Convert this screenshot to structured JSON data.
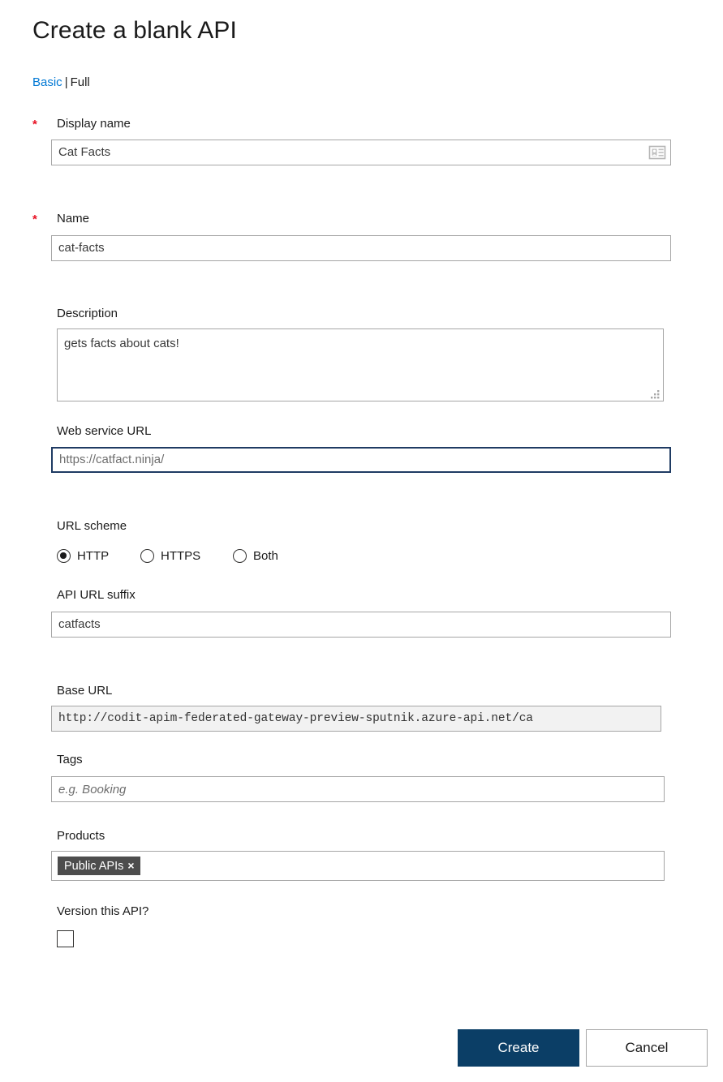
{
  "page": {
    "title": "Create a blank API"
  },
  "mode_switch": {
    "basic_label": "Basic",
    "separator": "|",
    "full_label": "Full"
  },
  "required_marker": "*",
  "fields": {
    "display_name": {
      "label": "Display name",
      "value": "Cat Facts",
      "required": true,
      "icon": "contact-card-icon"
    },
    "name": {
      "label": "Name",
      "value": "cat-facts",
      "required": true
    },
    "description": {
      "label": "Description",
      "value": "gets facts about cats!",
      "required": false
    },
    "web_service_url": {
      "label": "Web service URL",
      "value": "https://catfact.ninja/",
      "required": false,
      "focused": true
    },
    "url_scheme": {
      "label": "URL scheme",
      "selected": "HTTP",
      "options": [
        {
          "label": "HTTP",
          "checked": true
        },
        {
          "label": "HTTPS",
          "checked": false
        },
        {
          "label": "Both",
          "checked": false
        }
      ]
    },
    "api_url_suffix": {
      "label": "API URL suffix",
      "value": "catfacts",
      "required": false
    },
    "base_url": {
      "label": "Base URL",
      "value": "http://codit-apim-federated-gateway-preview-sputnik.azure-api.net/ca",
      "readonly": true
    },
    "tags": {
      "label": "Tags",
      "value": "",
      "placeholder": "e.g. Booking"
    },
    "products": {
      "label": "Products",
      "chips": [
        {
          "label": "Public APIs",
          "remove_label": "×"
        }
      ]
    },
    "version_this_api": {
      "label": "Version this API?",
      "checked": false
    }
  },
  "actions": {
    "create_label": "Create",
    "cancel_label": "Cancel"
  },
  "colors": {
    "link": "#0078d4",
    "required_star": "#e81123",
    "primary_button": "#0b3e66",
    "chip_background": "#4d4d4d",
    "field_border": "#a6a6a6",
    "focus_border": "#1f3b63",
    "readonly_background": "#f2f2f2"
  }
}
